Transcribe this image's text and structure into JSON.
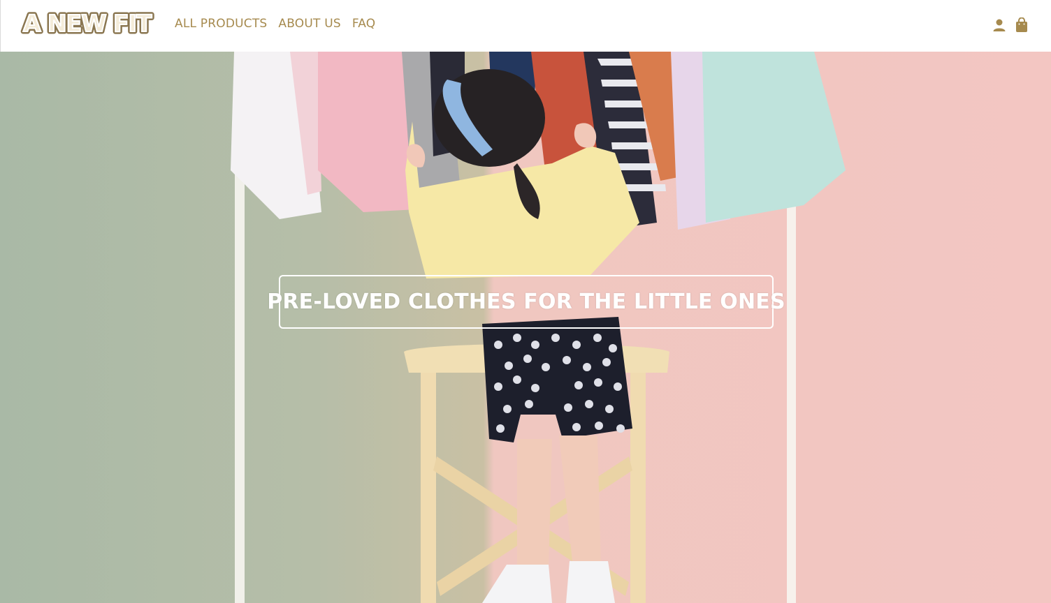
{
  "brand": {
    "logo_text": "A NEW FIT",
    "accent_color": "#a68a4e"
  },
  "nav": {
    "items": [
      {
        "label": "ALL PRODUCTS"
      },
      {
        "label": "ABOUT US"
      },
      {
        "label": "FAQ"
      }
    ]
  },
  "header_icons": {
    "account": "user-icon",
    "cart": "shopping-bag-icon"
  },
  "hero": {
    "title": "PRE-LOVED CLOTHES FOR THE LITTLE ONES",
    "image": "photo of toddler in yellow top and polka-dot shorts standing on a chair reaching a clothing rack"
  }
}
